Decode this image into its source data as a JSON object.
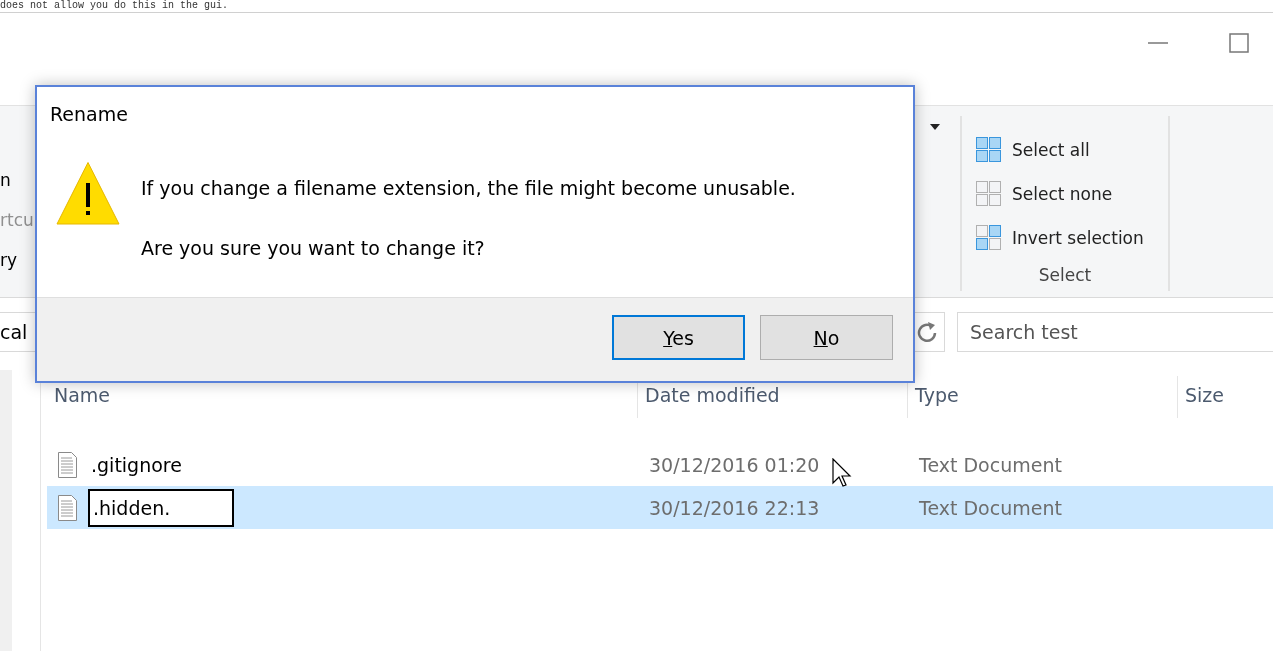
{
  "background_text": "does not allow you do this in the gui.",
  "ribbon": {
    "fragments": [
      {
        "text": "n",
        "kind": "command"
      },
      {
        "text": "rtcu",
        "kind": "dim"
      },
      {
        "text": "ry",
        "kind": "command"
      }
    ],
    "select_group": {
      "title": "Select",
      "items": [
        {
          "label": "Select all",
          "kind": "all"
        },
        {
          "label": "Select none",
          "kind": "none"
        },
        {
          "label": "Invert selection",
          "kind": "invert"
        }
      ]
    }
  },
  "address_bar": {
    "path": "cal"
  },
  "search": {
    "placeholder": "Search test"
  },
  "file_list": {
    "columns": [
      "Name",
      "Date modified",
      "Type",
      "Size"
    ],
    "rows": [
      {
        "name": ".gitignore",
        "date": "30/12/2016 01:20",
        "type": "Text Document",
        "selected": false,
        "editing": false
      },
      {
        "name": ".hidden.",
        "date": "30/12/2016 22:13",
        "type": "Text Document",
        "selected": true,
        "editing": true
      }
    ]
  },
  "dialog": {
    "title": "Rename",
    "message": "If you change a filename extension, the file might become unusable.",
    "question": "Are you sure you want to change it?",
    "buttons": [
      {
        "label": "Yes",
        "default": true
      },
      {
        "label": "No",
        "default": false
      }
    ]
  }
}
